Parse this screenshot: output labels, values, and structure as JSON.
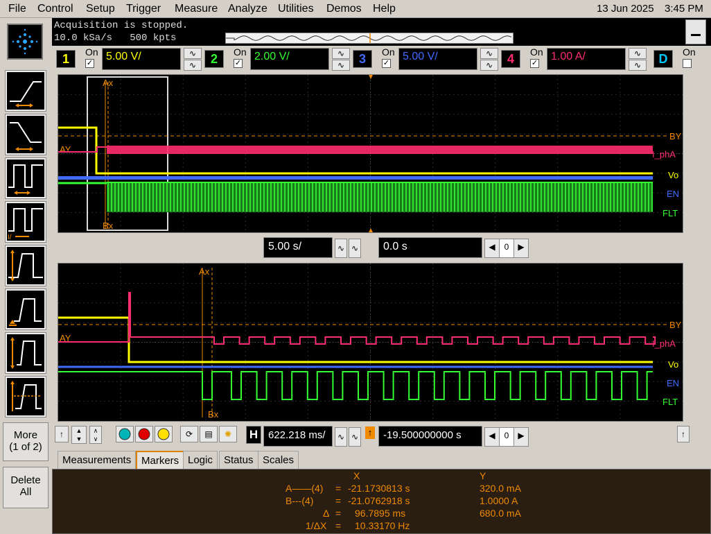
{
  "menu": {
    "items": [
      "File",
      "Control",
      "Setup",
      "Trigger",
      "Measure",
      "Analyze",
      "Utilities",
      "Demos",
      "Help"
    ],
    "date": "13 Jun 2025",
    "time": "3:45 PM"
  },
  "acquisition": {
    "status": "Acquisition is stopped.",
    "rate": "10.0 kSa/s",
    "points": "500 kpts"
  },
  "channels": [
    {
      "num": "1",
      "on_label": "On",
      "scale": "5.00 V/",
      "color": "#ffff00",
      "checked": true
    },
    {
      "num": "2",
      "on_label": "On",
      "scale": "2.00 V/",
      "color": "#33ff33",
      "checked": true
    },
    {
      "num": "3",
      "on_label": "On",
      "scale": "5.00 V/",
      "color": "#3f6bff",
      "checked": true
    },
    {
      "num": "4",
      "on_label": "On",
      "scale": "1.00 A/",
      "color": "#ff2d6f",
      "checked": true
    },
    {
      "num": "D",
      "on_label": "On",
      "checked": false,
      "color": "#00c8ff"
    }
  ],
  "waveforms": {
    "labels": {
      "phA": "I_phA",
      "vo": "Vo",
      "en": "EN",
      "flt": "FLT"
    },
    "markers": {
      "ax": "Ax",
      "bx": "Bx",
      "ay": "AY",
      "by": "BY"
    },
    "channel_tags": {
      "ch4": "4",
      "ch1": "1",
      "ch3": "3",
      "ch2": "2"
    }
  },
  "timebase": {
    "scale": "5.00 s/",
    "position": "0.0 s",
    "stepper": "0"
  },
  "zoom": {
    "scale": "622.218 ms/",
    "position": "-19.500000000 s",
    "stepper": "0",
    "h_label": "H"
  },
  "side_buttons": {
    "more": "More",
    "more_sub": "(1 of 2)",
    "delete_l1": "Delete",
    "delete_l2": "All"
  },
  "tabs": {
    "measurements": "Measurements",
    "markers": "Markers",
    "logic": "Logic",
    "status": "Status",
    "scales": "Scales"
  },
  "marker_readout": {
    "x_header": "X",
    "y_header": "Y",
    "a_label": "A——(4)",
    "a_x": "-21.1730813 s",
    "a_y": "320.0 mA",
    "b_label": "B---(4)",
    "b_x": "-21.0762918 s",
    "b_y": "1.0000 A",
    "delta_label": "Δ",
    "delta_x": "96.7895 ms",
    "delta_y": "680.0 mA",
    "inv_label": "1/ΔX",
    "inv_x": "10.33170 Hz"
  }
}
